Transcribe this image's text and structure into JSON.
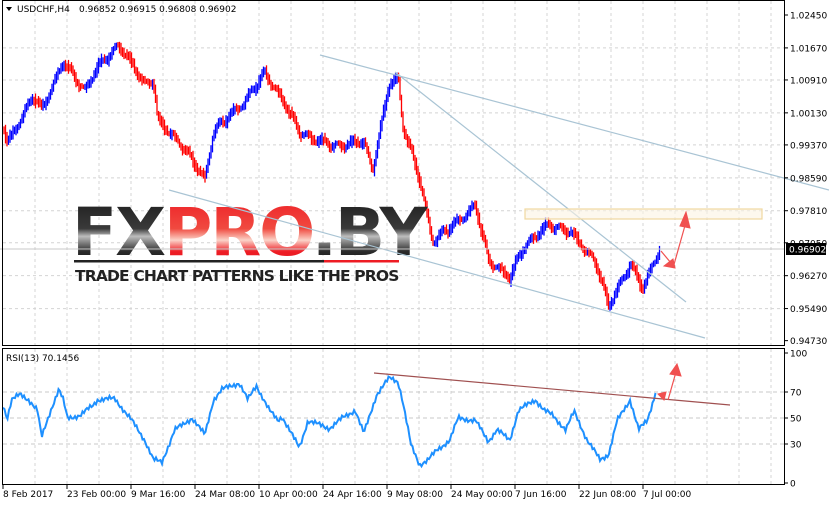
{
  "header": {
    "symbol_label": "USDCHF,H4",
    "ohlc": "0.96852 0.96915 0.96808 0.96902"
  },
  "rsi_panel": {
    "label": "RSI(13) 70.1456"
  },
  "logo": {
    "part1": "FX",
    "part2": "PRO",
    "part3": ".BY",
    "tagline": "TRADE CHART PATTERNS LIKE THE PROS"
  },
  "colors": {
    "bull": "#0000ff",
    "bear": "#ff0000",
    "rsi": "#1e90ff",
    "trendline": "#a9c4d4",
    "rsi_resistance": "#a05050",
    "arrow": "#f05050",
    "zone": "#f0d8a0"
  },
  "chart_data": [
    {
      "type": "line",
      "title": "USDCHF,H4",
      "current_price": "0.96902",
      "ylim": [
        0.9473,
        1.0245
      ],
      "y_ticks": [
        "1.02450",
        "1.01670",
        "1.00910",
        "1.00130",
        "0.99370",
        "0.98590",
        "0.97810",
        "0.97050",
        "0.96270",
        "0.95490",
        "0.94730"
      ],
      "x_ticks": [
        {
          "label": "8 Feb 2017",
          "date": "2017-02-08"
        },
        {
          "label": "23 Feb 00:00",
          "date": "2017-02-23"
        },
        {
          "label": "9 Mar 16:00",
          "date": "2017-03-09"
        },
        {
          "label": "24 Mar 08:00",
          "date": "2017-03-24"
        },
        {
          "label": "10 Apr 00:00",
          "date": "2017-04-10"
        },
        {
          "label": "24 Apr 16:00",
          "date": "2017-04-24"
        },
        {
          "label": "9 May 08:00",
          "date": "2017-05-09"
        },
        {
          "label": "24 May 00:00",
          "date": "2017-05-24"
        },
        {
          "label": "7 Jun 16:00",
          "date": "2017-06-07"
        },
        {
          "label": "22 Jun 08:00",
          "date": "2017-06-22"
        },
        {
          "label": "7 Jul 00:00",
          "date": "2017-07-07"
        }
      ],
      "grid": true,
      "series": [
        {
          "points": [
            [
              "2017-02-08",
              0.9984
            ],
            [
              "2017-02-09",
              0.9937
            ],
            [
              "2017-02-15",
              1.0055
            ],
            [
              "2017-02-17",
              1.0025
            ],
            [
              "2017-02-22",
              1.0138
            ],
            [
              "2017-02-27",
              1.0067
            ],
            [
              "2017-03-02",
              1.0119
            ],
            [
              "2017-03-07",
              1.0169
            ],
            [
              "2017-03-13",
              1.0079
            ],
            [
              "2017-03-15",
              1.0091
            ],
            [
              "2017-03-16",
              0.9996
            ],
            [
              "2017-03-22",
              0.9937
            ],
            [
              "2017-03-27",
              0.9859
            ],
            [
              "2017-03-29",
              0.9972
            ],
            [
              "2017-04-05",
              1.0032
            ],
            [
              "2017-04-10",
              1.0103
            ],
            [
              "2017-04-14",
              1.0044
            ],
            [
              "2017-04-18",
              0.9972
            ],
            [
              "2017-04-21",
              0.9956
            ],
            [
              "2017-04-27",
              0.9937
            ],
            [
              "2017-05-03",
              0.9944
            ],
            [
              "2017-05-05",
              0.9873
            ],
            [
              "2017-05-09",
              1.0079
            ],
            [
              "2017-05-11",
              1.0091
            ],
            [
              "2017-05-12",
              0.9984
            ],
            [
              "2017-05-16",
              0.9854
            ],
            [
              "2017-05-19",
              0.9712
            ],
            [
              "2017-05-29",
              0.9795
            ],
            [
              "2017-06-01",
              0.9664
            ],
            [
              "2017-06-06",
              0.9617
            ],
            [
              "2017-06-09",
              0.9688
            ],
            [
              "2017-06-15",
              0.9747
            ],
            [
              "2017-06-20",
              0.9735
            ],
            [
              "2017-06-26",
              0.9664
            ],
            [
              "2017-06-29",
              0.9557
            ],
            [
              "2017-07-04",
              0.9652
            ],
            [
              "2017-07-07",
              0.9593
            ],
            [
              "2017-07-11",
              0.96902
            ]
          ]
        }
      ]
    },
    {
      "type": "line",
      "title": "RSI(13) 70.1456",
      "ylim": [
        0,
        100
      ],
      "y_ticks": [
        "100",
        "70",
        "50",
        "30",
        "0"
      ],
      "grid": true,
      "series": [
        {
          "points": [
            [
              "2017-02-08",
              60
            ],
            [
              "2017-02-09",
              50
            ],
            [
              "2017-02-10",
              64
            ],
            [
              "2017-02-12",
              68
            ],
            [
              "2017-02-14",
              64
            ],
            [
              "2017-02-16",
              56
            ],
            [
              "2017-02-17",
              35
            ],
            [
              "2017-02-19",
              55
            ],
            [
              "2017-02-21",
              72
            ],
            [
              "2017-02-22",
              64
            ],
            [
              "2017-02-23",
              50
            ],
            [
              "2017-02-26",
              52
            ],
            [
              "2017-03-01",
              60
            ],
            [
              "2017-03-02",
              64
            ],
            [
              "2017-03-06",
              65
            ],
            [
              "2017-03-10",
              48
            ],
            [
              "2017-03-13",
              33
            ],
            [
              "2017-03-15",
              18
            ],
            [
              "2017-03-17",
              16
            ],
            [
              "2017-03-20",
              41
            ],
            [
              "2017-03-22",
              45
            ],
            [
              "2017-03-24",
              50
            ],
            [
              "2017-03-27",
              37
            ],
            [
              "2017-03-29",
              64
            ],
            [
              "2017-03-31",
              72
            ],
            [
              "2017-04-04",
              77
            ],
            [
              "2017-04-06",
              64
            ],
            [
              "2017-04-08",
              75
            ],
            [
              "2017-04-11",
              56
            ],
            [
              "2017-04-13",
              48
            ],
            [
              "2017-04-14",
              51
            ],
            [
              "2017-04-18",
              27
            ],
            [
              "2017-04-20",
              48
            ],
            [
              "2017-04-25",
              42
            ],
            [
              "2017-04-28",
              50
            ],
            [
              "2017-05-01",
              56
            ],
            [
              "2017-05-03",
              38
            ],
            [
              "2017-05-06",
              68
            ],
            [
              "2017-05-09",
              81
            ],
            [
              "2017-05-11",
              78
            ],
            [
              "2017-05-12",
              64
            ],
            [
              "2017-05-14",
              29
            ],
            [
              "2017-05-16",
              14
            ],
            [
              "2017-05-18",
              18
            ],
            [
              "2017-05-20",
              25
            ],
            [
              "2017-05-23",
              33
            ],
            [
              "2017-05-25",
              50
            ],
            [
              "2017-05-29",
              48
            ],
            [
              "2017-06-01",
              32
            ],
            [
              "2017-06-03",
              41
            ],
            [
              "2017-06-06",
              33
            ],
            [
              "2017-06-08",
              56
            ],
            [
              "2017-06-12",
              64
            ],
            [
              "2017-06-14",
              56
            ],
            [
              "2017-06-16",
              52
            ],
            [
              "2017-06-19",
              41
            ],
            [
              "2017-06-21",
              55
            ],
            [
              "2017-06-24",
              33
            ],
            [
              "2017-06-27",
              18
            ],
            [
              "2017-06-29",
              22
            ],
            [
              "2017-07-01",
              48
            ],
            [
              "2017-07-04",
              64
            ],
            [
              "2017-07-06",
              41
            ],
            [
              "2017-07-08",
              48
            ],
            [
              "2017-07-10",
              70.1456
            ]
          ]
        }
      ]
    }
  ]
}
